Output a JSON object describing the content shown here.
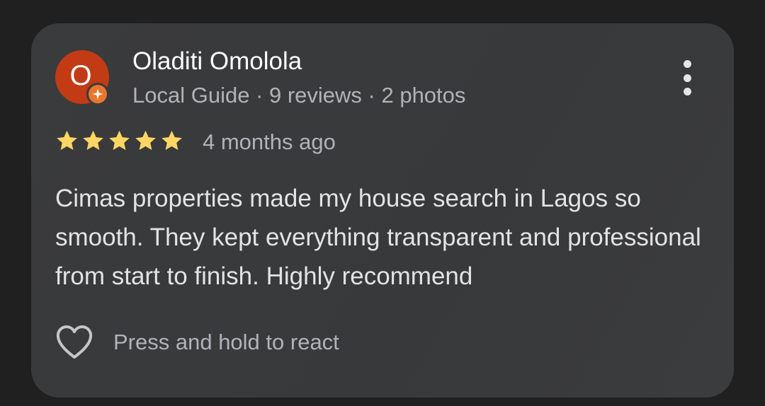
{
  "review": {
    "avatar_letter": "O",
    "reviewer_name": "Oladiti Omolola",
    "reviewer_meta": "Local Guide · 9 reviews · 2 photos",
    "rating": 5,
    "rating_max": 5,
    "time_ago": "4 months ago",
    "text": "Cimas properties made my house search in Lagos so smooth. They kept everything transparent and professional from start to finish. Highly recommend",
    "react_hint": "Press and hold to react"
  },
  "colors": {
    "background": "#202020",
    "card": "#3a3b3d",
    "avatar": "#c23b14",
    "guide_badge": "#e8772e",
    "star": "#fdd663"
  },
  "icons": {
    "badge": "local-guide-star-icon",
    "star": "star-icon",
    "menu": "more-vertical-icon",
    "react": "heart-outline-icon"
  }
}
